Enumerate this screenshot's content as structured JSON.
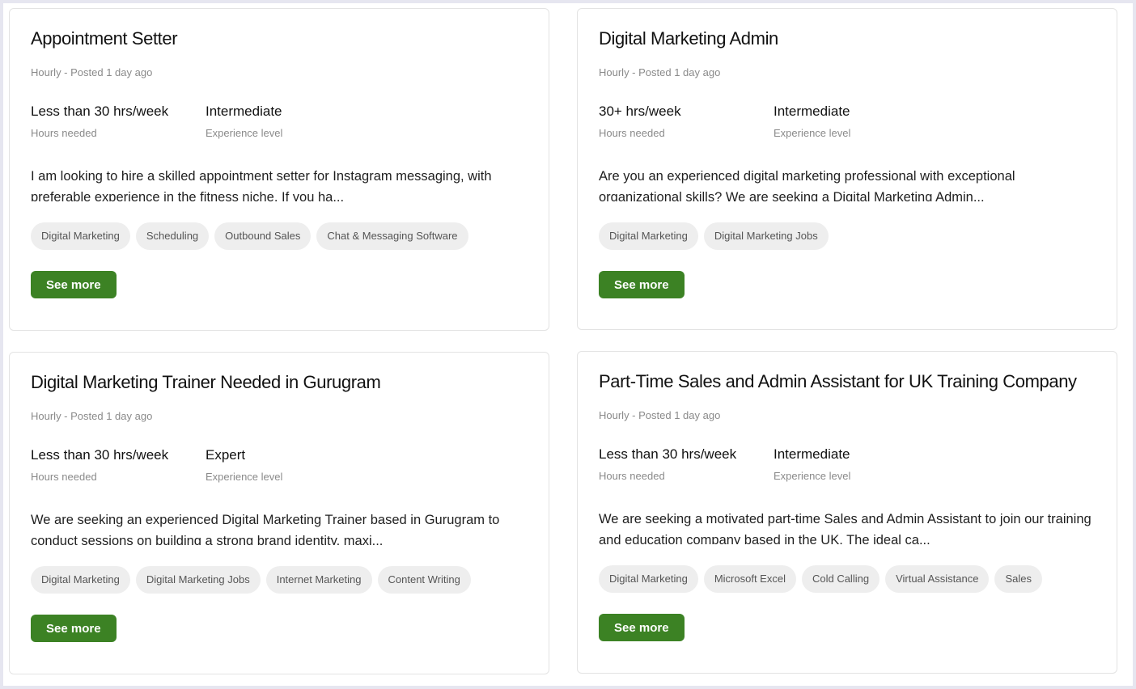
{
  "jobs": [
    {
      "title": "Appointment Setter",
      "posted": "Hourly - Posted 1 day ago",
      "hours_value": "Less than 30 hrs/week",
      "hours_label": "Hours needed",
      "level_value": "Intermediate",
      "level_label": "Experience level",
      "description": "I am looking to hire a skilled appointment setter for Instagram messaging, with preferable experience in the fitness niche. If you ha...",
      "tags": [
        "Digital Marketing",
        "Scheduling",
        "Outbound Sales",
        "Chat & Messaging Software"
      ],
      "button_label": "See more"
    },
    {
      "title": "Digital Marketing Admin",
      "posted": "Hourly - Posted 1 day ago",
      "hours_value": "30+ hrs/week",
      "hours_label": "Hours needed",
      "level_value": "Intermediate",
      "level_label": "Experience level",
      "description": "Are you an experienced digital marketing professional with exceptional organizational skills? We are seeking a Digital Marketing Admin...",
      "tags": [
        "Digital Marketing",
        "Digital Marketing Jobs"
      ],
      "button_label": "See more"
    },
    {
      "title": "Digital Marketing Trainer Needed in Gurugram",
      "posted": "Hourly - Posted 1 day ago",
      "hours_value": "Less than 30 hrs/week",
      "hours_label": "Hours needed",
      "level_value": "Expert",
      "level_label": "Experience level",
      "description": "We are seeking an experienced Digital Marketing Trainer based in Gurugram to conduct sessions on building a strong brand identity, maxi...",
      "tags": [
        "Digital Marketing",
        "Digital Marketing Jobs",
        "Internet Marketing",
        "Content Writing"
      ],
      "button_label": "See more"
    },
    {
      "title": "Part-Time Sales and Admin Assistant for UK Training Company",
      "posted": "Hourly - Posted 1 day ago",
      "hours_value": "Less than 30 hrs/week",
      "hours_label": "Hours needed",
      "level_value": "Intermediate",
      "level_label": "Experience level",
      "description": "We are seeking a motivated part-time Sales and Admin Assistant to join our training and education company based in the UK. The ideal ca...",
      "tags": [
        "Digital Marketing",
        "Microsoft Excel",
        "Cold Calling",
        "Virtual Assistance",
        "Sales"
      ],
      "button_label": "See more"
    }
  ],
  "colors": {
    "button_bg": "#3c8224",
    "tag_bg": "#eeeeee",
    "border": "#e3e3e3",
    "page_bg": "#e6e6f0"
  }
}
